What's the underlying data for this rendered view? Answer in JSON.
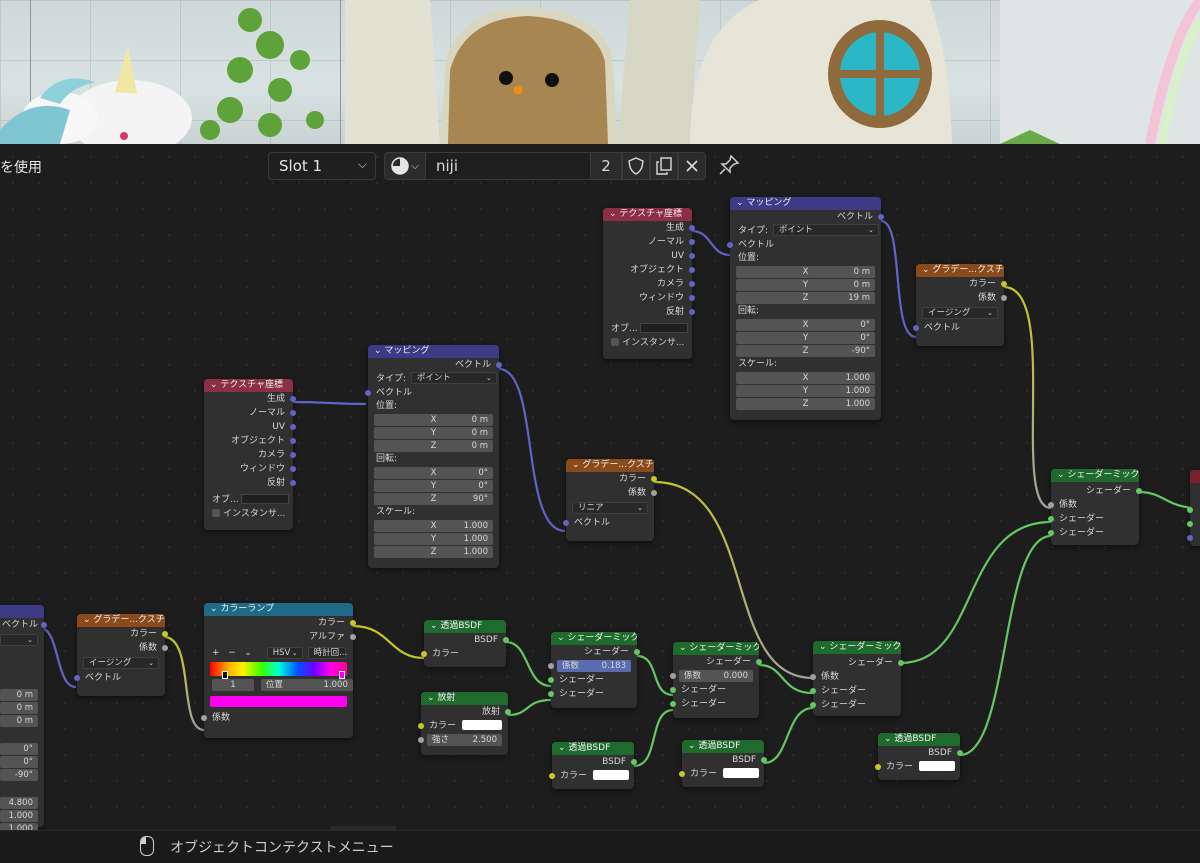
{
  "header": {
    "left_label": "を使用",
    "slot_label": "Slot 1",
    "material_name": "niji",
    "material_users": "2"
  },
  "nodes": {
    "texcoord1": {
      "title": "テクスチャ座標",
      "outputs": [
        "生成",
        "ノーマル",
        "UV",
        "オブジェクト",
        "カメラ",
        "ウィンドウ",
        "反射"
      ],
      "object_label": "オブ...",
      "instancer_label": "インスタンサ..."
    },
    "texcoord2": {
      "title": "テクスチャ座標",
      "outputs": [
        "生成",
        "ノーマル",
        "UV",
        "オブジェクト",
        "カメラ",
        "ウィンドウ",
        "反射"
      ],
      "object_label": "オブ...",
      "instancer_label": "インスタンサ..."
    },
    "mapping1": {
      "title": "マッピング",
      "out_vector": "ベクトル",
      "type_label": "タイプ:",
      "type_value": "ポイント",
      "in_vector": "ベクトル",
      "location_label": "位置:",
      "location": [
        [
          "X",
          "0 m"
        ],
        [
          "Y",
          "0 m"
        ],
        [
          "Z",
          "0 m"
        ]
      ],
      "rotation_label": "回転:",
      "rotation": [
        [
          "X",
          "0°"
        ],
        [
          "Y",
          "0°"
        ],
        [
          "Z",
          "90°"
        ]
      ],
      "scale_label": "スケール:",
      "scale": [
        [
          "X",
          "1.000"
        ],
        [
          "Y",
          "1.000"
        ],
        [
          "Z",
          "1.000"
        ]
      ]
    },
    "mapping2": {
      "title": "マッピング",
      "out_vector": "ベクトル",
      "type_label": "タイプ:",
      "type_value": "ポイント",
      "in_vector": "ベクトル",
      "location_label": "位置:",
      "location": [
        [
          "X",
          "0 m"
        ],
        [
          "Y",
          "0 m"
        ],
        [
          "Z",
          "19 m"
        ]
      ],
      "rotation_label": "回転:",
      "rotation": [
        [
          "X",
          "0°"
        ],
        [
          "Y",
          "0°"
        ],
        [
          "Z",
          "-90°"
        ]
      ],
      "scale_label": "スケール:",
      "scale": [
        [
          "X",
          "1.000"
        ],
        [
          "Y",
          "1.000"
        ],
        [
          "Z",
          "1.000"
        ]
      ]
    },
    "grad_top": {
      "title": "グラデー...クスチャ",
      "color": "カラー",
      "fac": "係数",
      "interp": "イージング",
      "vector": "ベクトル"
    },
    "grad_mid": {
      "title": "グラデー...クスチャ",
      "color": "カラー",
      "fac": "係数",
      "interp": "リニア",
      "vector": "ベクトル"
    },
    "grad_left": {
      "title": "グラデー...クスチャ",
      "color": "カラー",
      "fac": "係数",
      "interp": "イージング",
      "vector": "ベクトル"
    },
    "left_partial": {
      "vector": "ベクトル",
      "loc": [
        "0 m",
        "0 m",
        "0 m"
      ],
      "rot": [
        "0°",
        "0°",
        "-90°"
      ],
      "scale": [
        "4.800",
        "1.000",
        "1.000"
      ]
    },
    "colorramp": {
      "title": "カラーランプ",
      "out_color": "カラー",
      "out_alpha": "アルファ",
      "plus": "+",
      "minus": "−",
      "chev": "⌄",
      "mode": "HSV",
      "hue": "時計回...",
      "index": "1",
      "pos_label": "位置",
      "pos_value": "1.000",
      "fac": "係数"
    },
    "transp1": {
      "title": "透過BSDF",
      "out": "BSDF",
      "color": "カラー"
    },
    "emission": {
      "title": "放射",
      "out": "放射",
      "color": "カラー",
      "strength_label": "強さ",
      "strength_value": "2.500"
    },
    "mix1": {
      "title": "シェーダーミック...",
      "out": "シェーダー",
      "fac_label": "係数",
      "fac_value": "0.183",
      "in1": "シェーダー",
      "in2": "シェーダー"
    },
    "mix2": {
      "title": "シェーダーミック...",
      "out": "シェーダー",
      "fac_label": "係数",
      "fac_value": "0.000",
      "in1": "シェーダー",
      "in2": "シェーダー"
    },
    "mix3": {
      "title": "シェーダーミック...",
      "out": "シェーダー",
      "fac": "係数",
      "in1": "シェーダー",
      "in2": "シェーダー"
    },
    "mix4": {
      "title": "シェーダーミック...",
      "out": "シェーダー",
      "fac": "係数",
      "in1": "シェーダー",
      "in2": "シェーダー"
    },
    "transp2": {
      "title": "透過BSDF",
      "out": "BSDF",
      "color": "カラー"
    },
    "transp3": {
      "title": "透過BSDF",
      "out": "BSDF",
      "color": "カラー"
    },
    "transp4": {
      "title": "透過BSDF",
      "out": "BSDF",
      "color": "カラー"
    }
  },
  "status": {
    "hint": "オブジェクトコンテクストメニュー"
  },
  "colors": {
    "texture_header": "#8c2f45",
    "vector_header": "#3d3a86",
    "shader_header": "#1f6b2d",
    "converter_header": "#1f6b87",
    "vector_socket": "#6363c7",
    "color_socket": "#c7c729",
    "shader_socket": "#63c763"
  }
}
